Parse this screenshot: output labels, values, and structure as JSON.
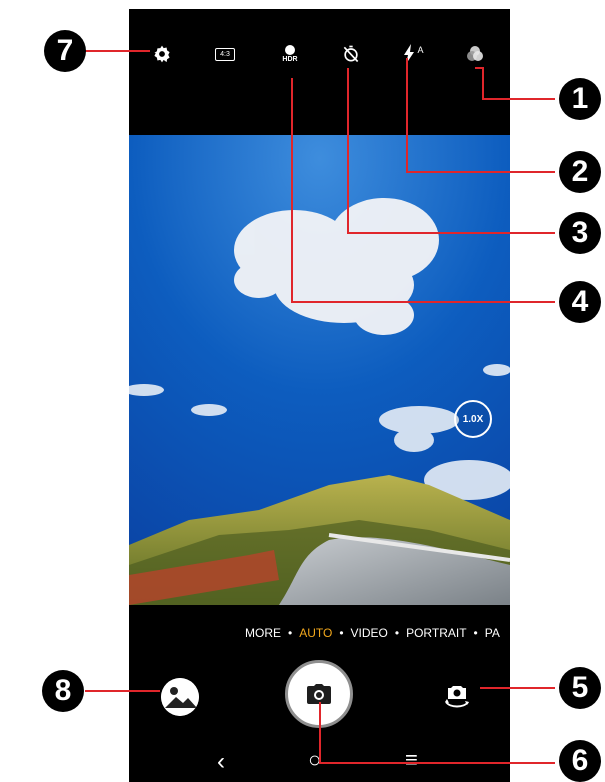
{
  "top_bar": {
    "aspect_ratio_label": "4:3",
    "hdr_label": "HDR",
    "flash_mode_label": "A",
    "icons": [
      "gear-icon",
      "aspect-ratio-icon",
      "hdr-icon",
      "timer-icon",
      "flash-auto-icon",
      "filter-icon"
    ]
  },
  "viewfinder": {
    "zoom_label": "1.0X"
  },
  "modes": {
    "items": [
      "MORE",
      "AUTO",
      "VIDEO",
      "PORTRAIT",
      "PA"
    ],
    "separator": "•",
    "active": "AUTO"
  },
  "navbar": {
    "back_glyph": "‹",
    "home_glyph": "○",
    "recents_glyph": "≡"
  },
  "callouts": [
    "1",
    "2",
    "3",
    "4",
    "5",
    "6",
    "7",
    "8"
  ],
  "colors": {
    "active_mode": "#f2a81d",
    "callout_line": "#e0262b",
    "phone_bg": "#000000"
  }
}
